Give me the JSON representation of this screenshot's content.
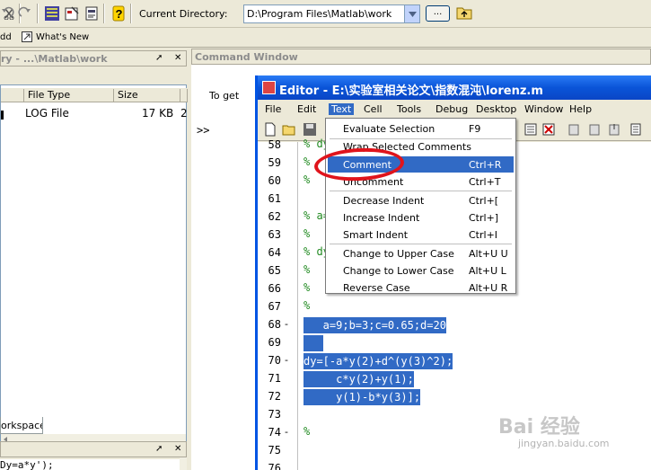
{
  "toolbar": {
    "current_directory_label": "Current Directory:",
    "current_directory_value": "D:\\Program Files\\Matlab\\work",
    "browse_label": "...",
    "icons": [
      "cut-icon",
      "copy-icon",
      "paste-icon",
      "undo-icon",
      "redo-icon",
      "simulink-icon",
      "guide-icon",
      "profiler-icon",
      "help-icon",
      "up-folder-icon"
    ]
  },
  "shortcuts": {
    "add_label": "dd",
    "whats_new_label": "What's New"
  },
  "left_panel": {
    "title": "ry - ...\\Matlab\\work",
    "columns": [
      "File Type",
      "Size",
      ""
    ],
    "rows": [
      {
        "type": "LOG File",
        "size": "17 KB",
        "extra": "2"
      }
    ],
    "workspace_tab": "orkspace",
    "history_line": "Dy=a*y');"
  },
  "command_window": {
    "title": "Command Window",
    "text": "To get",
    "prompt": ">>"
  },
  "editor": {
    "title": "Editor - E:\\实验室相关论文\\指数混沌\\lorenz.m",
    "menu": [
      "File",
      "Edit",
      "Text",
      "Cell",
      "Tools",
      "Debug",
      "Desktop",
      "Window",
      "Help"
    ],
    "lines": [
      {
        "n": "58",
        "dash": "",
        "code": "% dy",
        "sel": false
      },
      {
        "n": "59",
        "dash": "",
        "code": "%",
        "sel": false
      },
      {
        "n": "60",
        "dash": "",
        "code": "%",
        "sel": false
      },
      {
        "n": "61",
        "dash": "",
        "code": "",
        "sel": false
      },
      {
        "n": "62",
        "dash": "",
        "code": "% a=",
        "sel": false
      },
      {
        "n": "63",
        "dash": "",
        "code": "%",
        "sel": false
      },
      {
        "n": "64",
        "dash": "",
        "code": "% dy",
        "sel": false
      },
      {
        "n": "65",
        "dash": "",
        "code": "%",
        "sel": false
      },
      {
        "n": "66",
        "dash": "",
        "code": "%",
        "sel": false
      },
      {
        "n": "67",
        "dash": "",
        "code": "%",
        "sel": false
      },
      {
        "n": "68",
        "dash": "-",
        "code": "   a=9;b=3;c=0.65;d=20",
        "sel": true
      },
      {
        "n": "69",
        "dash": "",
        "code": "   ",
        "sel": true
      },
      {
        "n": "70",
        "dash": "-",
        "code": "dy=[-a*y(2)+d^(y(3)^2);",
        "sel": true
      },
      {
        "n": "71",
        "dash": "",
        "code": "     c*y(2)+y(1);",
        "sel": true
      },
      {
        "n": "72",
        "dash": "",
        "code": "     y(1)-b*y(3)];",
        "sel": true
      },
      {
        "n": "73",
        "dash": "",
        "code": "",
        "sel": false
      },
      {
        "n": "74",
        "dash": "-",
        "code": "%",
        "sel": false
      },
      {
        "n": "75",
        "dash": "",
        "code": "",
        "sel": false
      },
      {
        "n": "76",
        "dash": "",
        "code": "",
        "sel": false
      }
    ]
  },
  "text_menu": {
    "items": [
      {
        "label": "Evaluate Selection",
        "shortcut": "F9"
      },
      {
        "label": "Wrap Selected Comments",
        "shortcut": ""
      },
      {
        "label": "Comment",
        "shortcut": "Ctrl+R"
      },
      {
        "label": "Uncomment",
        "shortcut": "Ctrl+T"
      },
      {
        "label": "Decrease Indent",
        "shortcut": "Ctrl+["
      },
      {
        "label": "Increase Indent",
        "shortcut": "Ctrl+]"
      },
      {
        "label": "Smart Indent",
        "shortcut": "Ctrl+I"
      },
      {
        "label": "Change to Upper Case",
        "shortcut": "Alt+U U"
      },
      {
        "label": "Change to Lower Case",
        "shortcut": "Alt+U L"
      },
      {
        "label": "Reverse Case",
        "shortcut": "Alt+U R"
      }
    ],
    "highlighted_index": 2
  },
  "watermark": {
    "main": "Bai 经验",
    "sub": "jingyan.baidu.com"
  },
  "colors": {
    "selection": "#316ac5",
    "annotation": "#e0141c",
    "title_bar": "#0a54d8",
    "comment": "#228b22"
  }
}
